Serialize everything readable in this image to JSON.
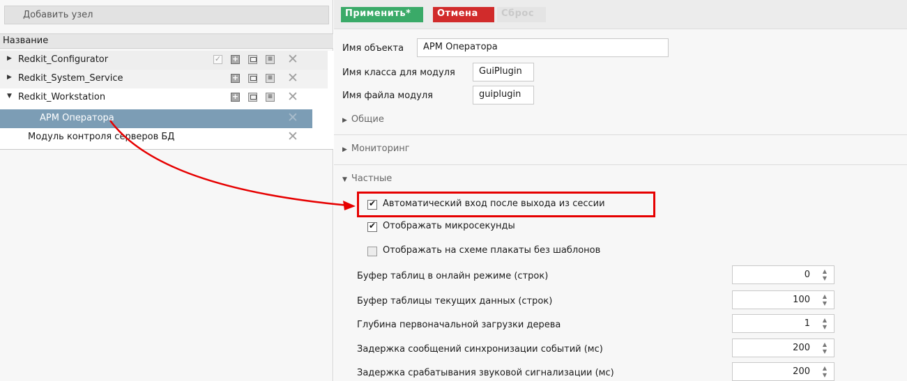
{
  "left_panel": {
    "add_node_label": "Добавить узел",
    "column_header": "Название",
    "tree": [
      {
        "label": "Redkit_Configurator",
        "expanded": false
      },
      {
        "label": "Redkit_System_Service",
        "expanded": false
      },
      {
        "label": "Redkit_Workstation",
        "expanded": true
      },
      {
        "label": "АРМ Оператора",
        "selected": true
      },
      {
        "label": "Модуль контроля серверов БД"
      }
    ]
  },
  "toolbar": {
    "apply_label": "Применить*",
    "cancel_label": "Отмена",
    "reset_label": "Сброс"
  },
  "fields": {
    "object_name_label": "Имя объекта",
    "object_name_value": "АРМ Оператора",
    "class_name_label": "Имя класса для модуля",
    "class_name_value": "GuiPlugin",
    "file_name_label": "Имя файла модуля",
    "file_name_value": "guiplugin"
  },
  "sections": {
    "general": "Общие",
    "monitoring": "Мониторинг",
    "private": "Частные"
  },
  "options": {
    "auto_login": {
      "label": "Автоматический вход после выхода из сессии",
      "checked": true
    },
    "show_microseconds": {
      "label": "Отображать микросекунды",
      "checked": true
    },
    "show_posters": {
      "label": "Отображать на схеме плакаты без шаблонов",
      "checked": false
    }
  },
  "spinners": [
    {
      "label": "Буфер таблиц в онлайн режиме (строк)",
      "value": "0"
    },
    {
      "label": "Буфер таблицы текущих данных (строк)",
      "value": "100"
    },
    {
      "label": "Глубина первоначальной загрузки дерева",
      "value": "1"
    },
    {
      "label": "Задержка сообщений синхронизации событий (мс)",
      "value": "200"
    },
    {
      "label": "Задержка срабатывания звуковой сигнализации (мс)",
      "value": "200"
    }
  ],
  "colors": {
    "apply": "#3aaa68",
    "cancel": "#d12b2b",
    "selection": "#7c9db5",
    "annotation": "#e60000"
  }
}
